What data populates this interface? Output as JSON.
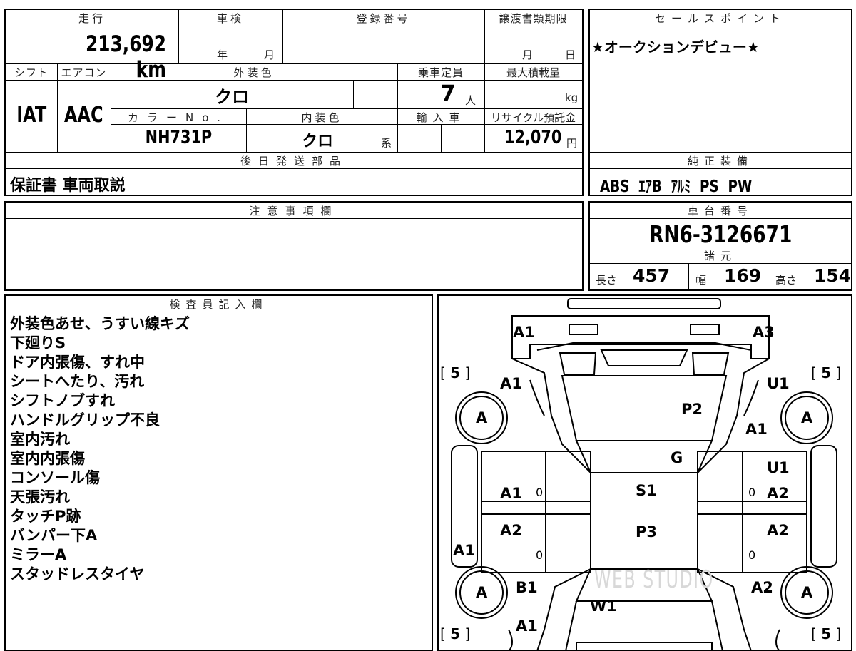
{
  "top": {
    "hdr_mileage": "走行",
    "mileage": "213,692",
    "mileage_unit": "km",
    "hdr_inspection": "車検",
    "inspection_year": "年",
    "inspection_month": "月",
    "hdr_reg_no": "登録番号",
    "hdr_transfer": "譲渡書類期限",
    "transfer_month": "月",
    "transfer_day": "日",
    "hdr_shift": "シフト",
    "shift": "IAT",
    "hdr_ac": "エアコン",
    "ac": "AAC",
    "hdr_ext_color": "外装色",
    "ext_color": "クロ",
    "hdr_capacity": "乗車定員",
    "capacity": "7",
    "capacity_unit": "人",
    "hdr_max_load": "最大積載量",
    "max_load_unit": "kg",
    "hdr_color_no": "カラーNo.",
    "color_no": "NH731P",
    "hdr_int_color": "内装色",
    "int_color": "クロ",
    "int_color_suffix": "系",
    "hdr_import": "輸入車",
    "hdr_recycle": "リサイクル預託金",
    "recycle": "12,070",
    "recycle_unit": "円",
    "hdr_later_parts": "後日発送部品",
    "later_parts": "保証書 車両取説"
  },
  "sales": {
    "hdr": "セールスポイント",
    "text": "★オークションデビュー★"
  },
  "equipment": {
    "hdr": "純正装備",
    "items": [
      "ABS",
      "ｴｱB",
      "ｱﾙﾐ",
      "PS",
      "PW"
    ]
  },
  "notes": {
    "hdr": "注意事項欄"
  },
  "chassis": {
    "hdr": "車台番号",
    "number": "RN6-3126671",
    "spec_hdr": "諸元",
    "length_label": "長さ",
    "length": "457",
    "width_label": "幅",
    "width": "169",
    "height_label": "高さ",
    "height": "154"
  },
  "inspector": {
    "hdr": "検査員記入欄",
    "lines": [
      "外装色あせ、うすい線キズ",
      "下廻りS",
      "ドア内張傷、すれ中",
      "シートへたり、汚れ",
      "シフトノブすれ",
      "ハンドルグリップ不良",
      "室内汚れ",
      "室内内張傷",
      "コンソール傷",
      "天張汚れ",
      "タッチP跡",
      "バンパー下A",
      "ミラーA",
      "スタッドレスタイヤ"
    ]
  },
  "diagram": {
    "marks": {
      "front_left": "A1",
      "front_right": "A3",
      "fender_fl": "A1",
      "fender_fr": "U1",
      "hood": "P2",
      "fr_right2": "A1",
      "windshield": "G",
      "door_fr": "U1",
      "door_fl": "A1",
      "roof": "S1",
      "door_fr2": "A2",
      "door_rl": "A2",
      "roof2": "P3",
      "door_rr": "A2",
      "side_left": "A1",
      "rear_fender_l": "B1",
      "rear_fender_r": "A2",
      "rear_window": "W1",
      "rear_l": "A1"
    },
    "tires": [
      "A",
      "A",
      "A",
      "A"
    ],
    "tread": [
      "5",
      "5",
      "5",
      "5"
    ],
    "zeros": [
      "0",
      "0",
      "0",
      "0"
    ],
    "watermark": "WEB STUDIO"
  }
}
